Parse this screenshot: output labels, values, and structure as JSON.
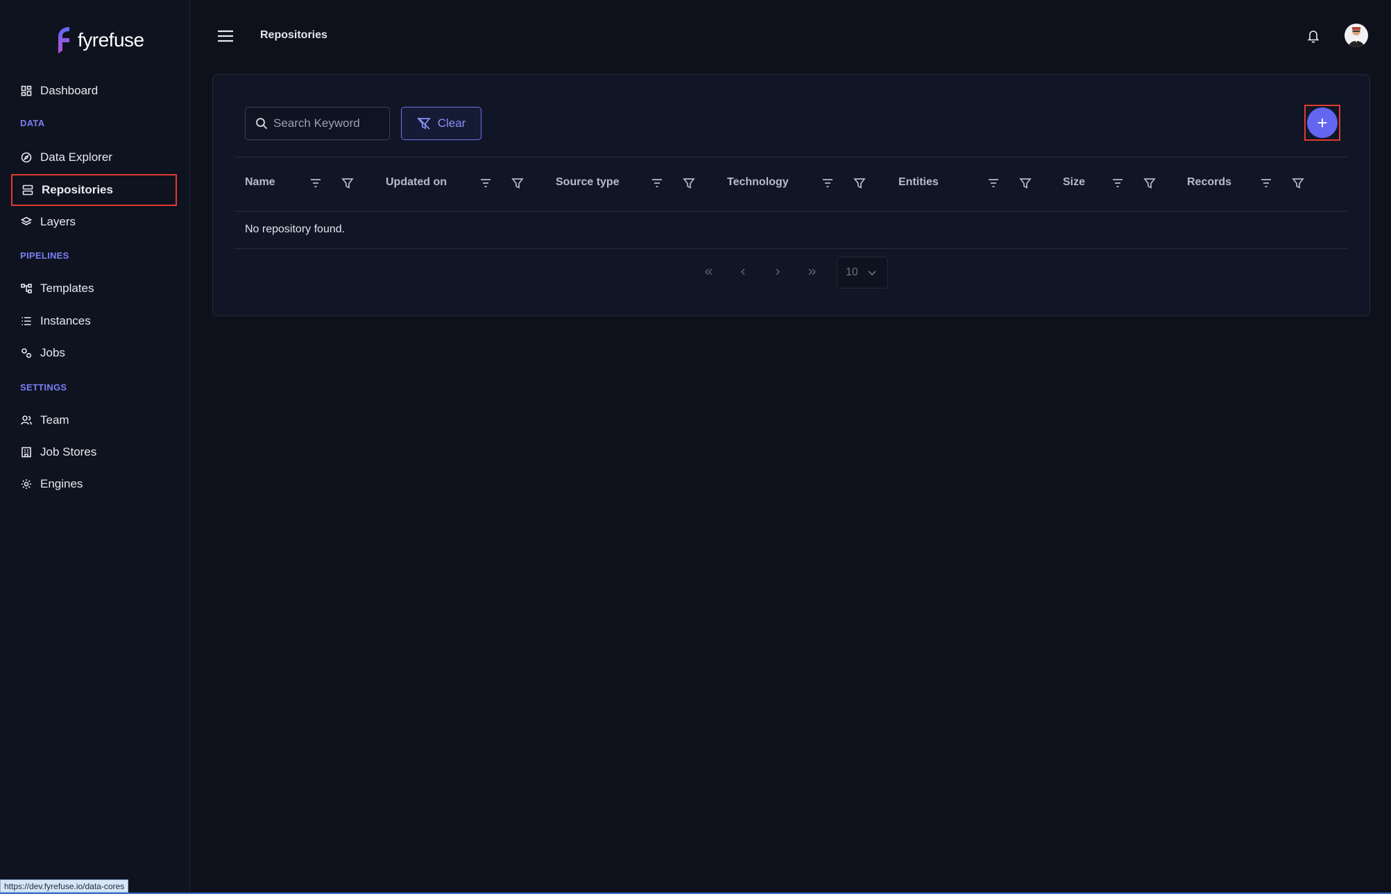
{
  "brand": {
    "name": "fyrefuse"
  },
  "sidebar": {
    "dashboard": "Dashboard",
    "sections": {
      "data": "DATA",
      "pipelines": "PIPELINES",
      "settings": "SETTINGS"
    },
    "data_items": [
      "Data Explorer",
      "Repositories",
      "Layers"
    ],
    "pipeline_items": [
      "Templates",
      "Instances",
      "Jobs"
    ],
    "settings_items": [
      "Team",
      "Job Stores",
      "Engines"
    ],
    "active": "Repositories"
  },
  "header": {
    "title": "Repositories"
  },
  "toolbar": {
    "search_placeholder": "Search Keyword",
    "search_value": "",
    "clear_label": "Clear",
    "add_label": "+"
  },
  "table": {
    "columns": [
      "Name",
      "Updated on",
      "Source type",
      "Technology",
      "Entities",
      "Size",
      "Records"
    ],
    "empty_message": "No repository found."
  },
  "pagination": {
    "first": "«",
    "prev": "‹",
    "next": "›",
    "last": "»",
    "page_size": "10"
  },
  "status_bar": {
    "url": "https://dev.fyrefuse.io/data-cores"
  },
  "colors": {
    "accent": "#6366f1",
    "section_label": "#7a7ff2",
    "highlight_border": "#e23a2e",
    "background": "#0e111c"
  }
}
